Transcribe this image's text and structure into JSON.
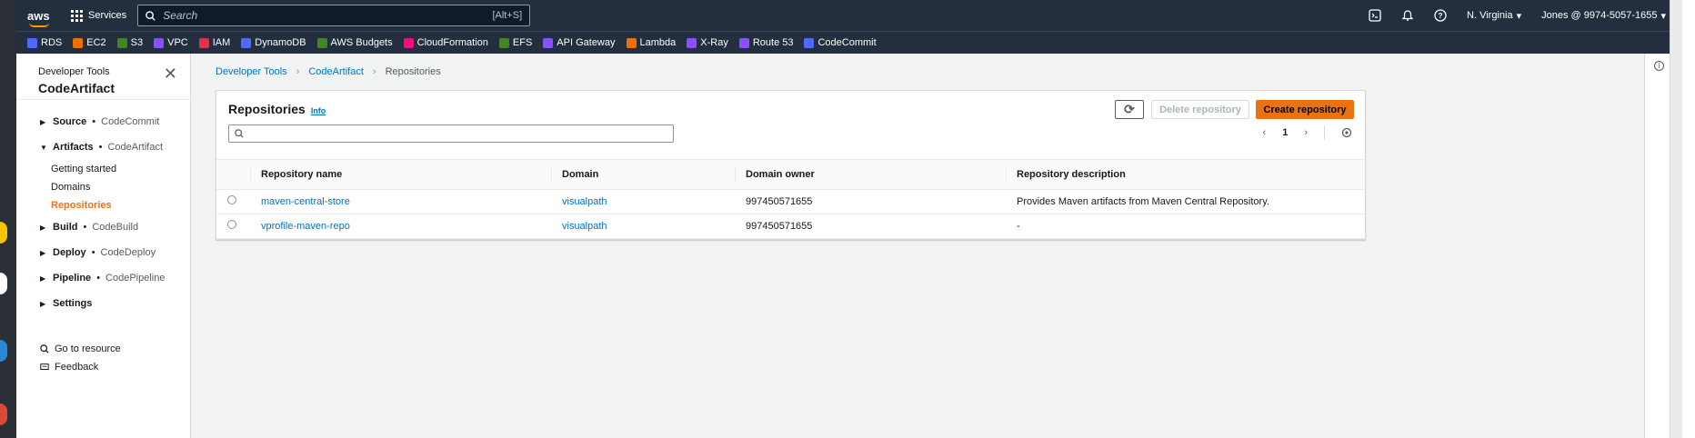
{
  "topnav": {
    "logo": "aws",
    "services_label": "Services",
    "search_placeholder": "Search",
    "search_shortcut": "[Alt+S]",
    "region": "N. Virginia",
    "account": "Jones @ 9974-5057-1655"
  },
  "favorites": [
    {
      "label": "RDS",
      "color": "#4d6bfe"
    },
    {
      "label": "EC2",
      "color": "#ed7100"
    },
    {
      "label": "S3",
      "color": "#3f8624"
    },
    {
      "label": "VPC",
      "color": "#8c4fff"
    },
    {
      "label": "IAM",
      "color": "#dd344c"
    },
    {
      "label": "DynamoDB",
      "color": "#4d6bfe"
    },
    {
      "label": "AWS Budgets",
      "color": "#3f8624"
    },
    {
      "label": "CloudFormation",
      "color": "#e7157b"
    },
    {
      "label": "EFS",
      "color": "#3f8624"
    },
    {
      "label": "API Gateway",
      "color": "#8c4fff"
    },
    {
      "label": "Lambda",
      "color": "#ed7100"
    },
    {
      "label": "X-Ray",
      "color": "#8c4fff"
    },
    {
      "label": "Route 53",
      "color": "#8c4fff"
    },
    {
      "label": "CodeCommit",
      "color": "#4d6bfe"
    }
  ],
  "sidenav": {
    "subtitle": "Developer Tools",
    "title": "CodeArtifact",
    "sections": [
      {
        "name": "Source",
        "service": "CodeCommit",
        "expanded": false
      },
      {
        "name": "Artifacts",
        "service": "CodeArtifact",
        "expanded": true
      },
      {
        "name": "Build",
        "service": "CodeBuild",
        "expanded": false
      },
      {
        "name": "Deploy",
        "service": "CodeDeploy",
        "expanded": false
      },
      {
        "name": "Pipeline",
        "service": "CodePipeline",
        "expanded": false
      },
      {
        "name": "Settings",
        "service": "",
        "expanded": false
      }
    ],
    "artifact_children": [
      "Getting started",
      "Domains",
      "Repositories"
    ],
    "footer": {
      "go_to_resource": "Go to resource",
      "feedback": "Feedback"
    }
  },
  "breadcrumb": [
    "Developer Tools",
    "CodeArtifact",
    "Repositories"
  ],
  "panel": {
    "title": "Repositories",
    "info": "Info",
    "delete_label": "Delete repository",
    "create_label": "Create repository",
    "page": "1",
    "columns": [
      "Repository name",
      "Domain",
      "Domain owner",
      "Repository description"
    ],
    "rows": [
      {
        "name": "maven-central-store",
        "domain": "visualpath",
        "owner": "997450571655",
        "description": "Provides Maven artifacts from Maven Central Repository."
      },
      {
        "name": "vprofile-maven-repo",
        "domain": "visualpath",
        "owner": "997450571655",
        "description": "-"
      }
    ]
  },
  "colors": {
    "nav_bg": "#232f3e",
    "accent": "#ec7211",
    "link": "#0073bb"
  }
}
